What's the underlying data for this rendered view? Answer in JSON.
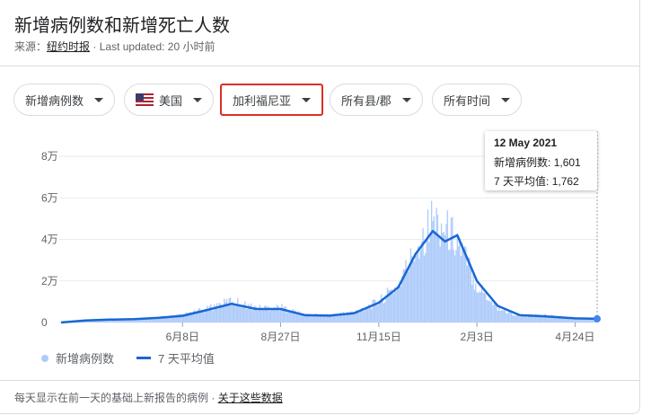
{
  "header": {
    "title": "新增病例数和新增死亡人数",
    "source_label": "来源：",
    "source_link": "纽约时报",
    "separator": "·",
    "updated": "Last updated: 20 小时前"
  },
  "filters": {
    "metric": "新增病例数",
    "country": "美国",
    "state": "加利福尼亚",
    "county": "所有县/郡",
    "time": "所有时间"
  },
  "tooltip": {
    "date": "12 May 2021",
    "cases_label": "新增病例数",
    "cases_value": "1,601",
    "avg_label": "7 天平均值",
    "avg_value": "1,762"
  },
  "legend": {
    "bars_label": "新增病例数",
    "line_label": "7 天平均值"
  },
  "footer": {
    "note": "每天显示在前一天的基础上新报告的病例",
    "separator": "·",
    "link": "关于这些数据"
  },
  "colors": {
    "bars": "#aecbfa",
    "line": "#1967d2",
    "highlight": "#d93025"
  },
  "chart_data": {
    "type": "bar",
    "y_tick_labels": [
      "0",
      "2万",
      "4万",
      "6万",
      "8万"
    ],
    "ylim": [
      0,
      80000
    ],
    "x_tick_labels": [
      "6月8日",
      "8月27日",
      "11月15日",
      "2月3日",
      "4月24日"
    ],
    "series": [
      {
        "name": "新增病例数",
        "kind": "bar",
        "note_values": "daily new cases (approx)",
        "x": [
          "2020-03-01",
          "2020-03-21",
          "2020-04-10",
          "2020-04-30",
          "2020-05-20",
          "2020-06-08",
          "2020-06-28",
          "2020-07-18",
          "2020-08-07",
          "2020-08-27",
          "2020-09-16",
          "2020-10-06",
          "2020-10-26",
          "2020-11-15",
          "2020-12-01",
          "2020-12-15",
          "2020-12-29",
          "2021-01-08",
          "2021-01-18",
          "2021-02-03",
          "2021-02-20",
          "2021-03-10",
          "2021-03-30",
          "2021-04-24",
          "2021-05-12"
        ],
        "values": [
          0,
          1200,
          1500,
          1600,
          2500,
          3500,
          6500,
          10500,
          7000,
          7500,
          3500,
          3500,
          5000,
          10000,
          18000,
          35000,
          50000,
          45000,
          40000,
          18000,
          7000,
          3000,
          3500,
          2000,
          1601
        ]
      },
      {
        "name": "7 天平均值",
        "kind": "line",
        "x": [
          "2020-03-01",
          "2020-03-21",
          "2020-04-10",
          "2020-04-30",
          "2020-05-20",
          "2020-06-08",
          "2020-06-28",
          "2020-07-18",
          "2020-08-07",
          "2020-08-27",
          "2020-09-16",
          "2020-10-06",
          "2020-10-26",
          "2020-11-15",
          "2020-12-01",
          "2020-12-15",
          "2020-12-29",
          "2021-01-08",
          "2021-01-18",
          "2021-02-03",
          "2021-02-20",
          "2021-03-10",
          "2021-03-30",
          "2021-04-24",
          "2021-05-12"
        ],
        "values": [
          0,
          1000,
          1400,
          1600,
          2300,
          3200,
          6000,
          9000,
          6500,
          6500,
          3500,
          3300,
          4500,
          9500,
          17000,
          33000,
          44000,
          39000,
          42000,
          20000,
          8000,
          3500,
          3000,
          2000,
          1762
        ]
      }
    ]
  }
}
